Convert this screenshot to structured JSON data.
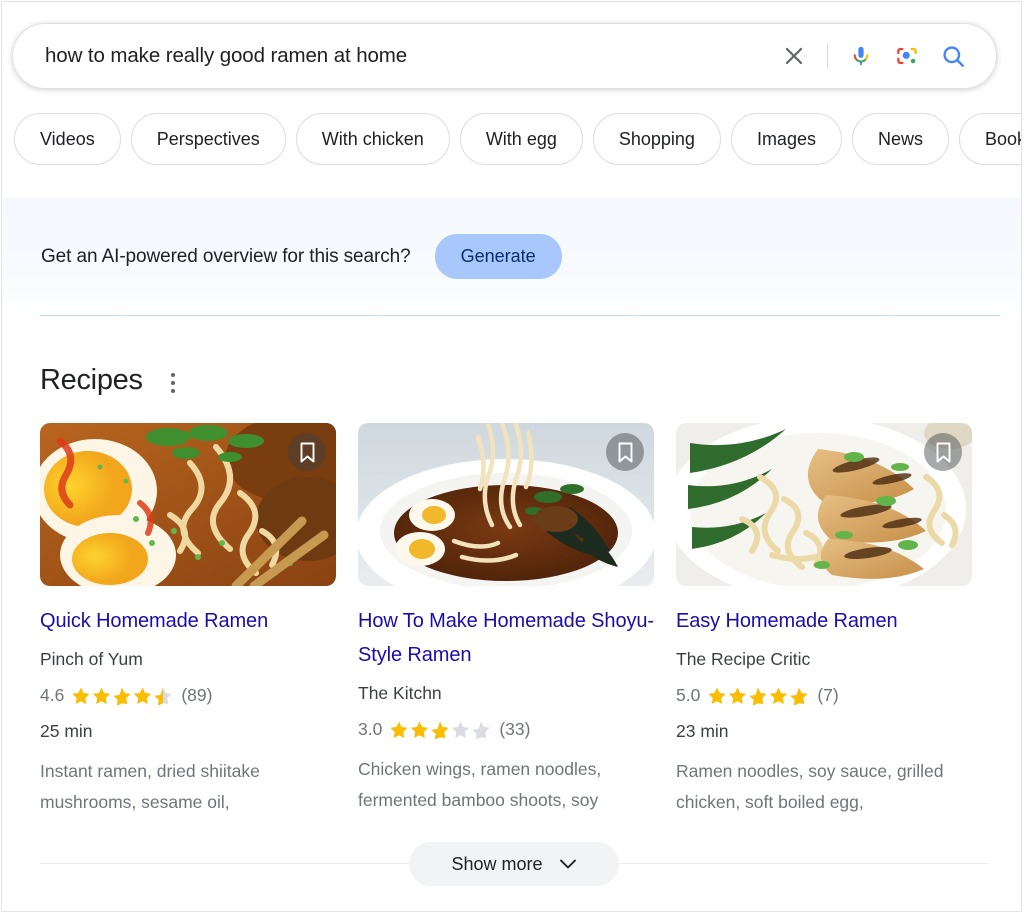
{
  "search": {
    "query": "how to make really good ramen at home",
    "placeholder": "Search",
    "clear_label": "Clear",
    "voice_label": "Search by voice",
    "lens_label": "Search by image",
    "submit_label": "Search"
  },
  "filter_chips": [
    {
      "label": "Videos"
    },
    {
      "label": "Perspectives"
    },
    {
      "label": "With chicken"
    },
    {
      "label": "With egg"
    },
    {
      "label": "Shopping"
    },
    {
      "label": "Images"
    },
    {
      "label": "News"
    },
    {
      "label": "Books"
    }
  ],
  "ai_banner": {
    "prompt": "Get an AI-powered overview for this search?",
    "button_label": "Generate",
    "button_bg": "#a8c7fa",
    "button_text_color": "#062e6f"
  },
  "recipes_module": {
    "title": "Recipes",
    "menu_label": "More options",
    "show_more_label": "Show more",
    "cards": [
      {
        "title": "Quick Homemade Ramen",
        "source": "Pinch of Yum",
        "rating_value": "4.6",
        "rating_stars": 4.5,
        "rating_count": "(89)",
        "time": "25 min",
        "ingredients": "Instant ramen, dried shiitake mushrooms, sesame oil,",
        "bookmark_label": "Save",
        "image_alt": "Close-up of ramen with soft egg, chili oil, scallions and chopsticks"
      },
      {
        "title": "How To Make Homemade Shoyu-Style Ramen",
        "source": "The Kitchn",
        "rating_value": "3.0",
        "rating_stars": 3.0,
        "rating_count": "(33)",
        "time": "",
        "ingredients": "Chicken wings, ramen noodles, fermented bamboo shoots, soy",
        "bookmark_label": "Save",
        "image_alt": "Shoyu ramen bowl with noodles lifted, halved eggs and nori"
      },
      {
        "title": "Easy Homemade Ramen",
        "source": "The Recipe Critic",
        "rating_value": "5.0",
        "rating_stars": 5.0,
        "rating_count": "(7)",
        "time": "23 min",
        "ingredients": "Ramen noodles, soy sauce, grilled chicken, soft boiled egg,",
        "bookmark_label": "Save",
        "image_alt": "Ramen bowl with sliced grilled chicken, greens and scallions"
      }
    ]
  },
  "colors": {
    "link": "#1a0dab",
    "star_filled": "#fbbc04",
    "star_empty": "#dadce0",
    "text_secondary": "#70757a",
    "chip_border": "#dadce0"
  }
}
